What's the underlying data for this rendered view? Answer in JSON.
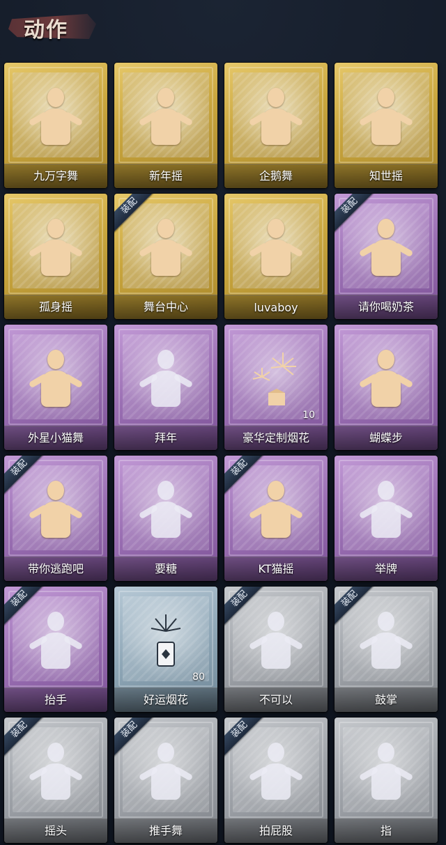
{
  "header": {
    "title": "动作"
  },
  "rows": [
    [
      {
        "label": "九万字舞",
        "rarity": "gold",
        "equipped": false
      },
      {
        "label": "新年摇",
        "rarity": "gold",
        "equipped": false
      },
      {
        "label": "企鹅舞",
        "rarity": "gold",
        "equipped": false
      },
      {
        "label": "知世摇",
        "rarity": "gold",
        "equipped": false
      }
    ],
    [
      {
        "label": "孤身摇",
        "rarity": "gold",
        "equipped": false
      },
      {
        "label": "舞台中心",
        "rarity": "gold",
        "equipped": true
      },
      {
        "label": "luvaboy",
        "rarity": "gold",
        "equipped": false
      },
      {
        "label": "请你喝奶茶",
        "rarity": "purple",
        "equipped": true
      }
    ],
    [
      {
        "label": "外星小猫舞",
        "rarity": "purple",
        "equipped": false
      },
      {
        "label": "拜年",
        "rarity": "purple",
        "equipped": false
      },
      {
        "label": "豪华定制烟花",
        "rarity": "purple",
        "equipped": false,
        "count": "10",
        "icon": "firework-box-icon"
      },
      {
        "label": "蝴蝶步",
        "rarity": "purple",
        "equipped": false
      }
    ],
    [
      {
        "label": "带你逃跑吧",
        "rarity": "purple",
        "equipped": true
      },
      {
        "label": "要糖",
        "rarity": "purple",
        "equipped": false
      },
      {
        "label": "KT猫摇",
        "rarity": "purple",
        "equipped": true
      },
      {
        "label": "举牌",
        "rarity": "purple",
        "equipped": false
      }
    ],
    [
      {
        "label": "抬手",
        "rarity": "purple",
        "equipped": true
      },
      {
        "label": "好运烟花",
        "rarity": "blue",
        "equipped": false,
        "count": "80",
        "icon": "firework-tube-icon"
      },
      {
        "label": "不可以",
        "rarity": "gray",
        "equipped": true
      },
      {
        "label": "鼓掌",
        "rarity": "gray",
        "equipped": true
      }
    ],
    [
      {
        "label": "摇头",
        "rarity": "gray",
        "equipped": true
      },
      {
        "label": "推手舞",
        "rarity": "gray",
        "equipped": true
      },
      {
        "label": "拍屁股",
        "rarity": "gray",
        "equipped": true
      },
      {
        "label": "指",
        "rarity": "gray",
        "equipped": false
      }
    ]
  ],
  "badge_text": "装配",
  "colors": {
    "gold": "#c9a63e",
    "purple": "#9a6fb3",
    "blue": "#8ea6b6",
    "gray": "#9ea2a8"
  }
}
